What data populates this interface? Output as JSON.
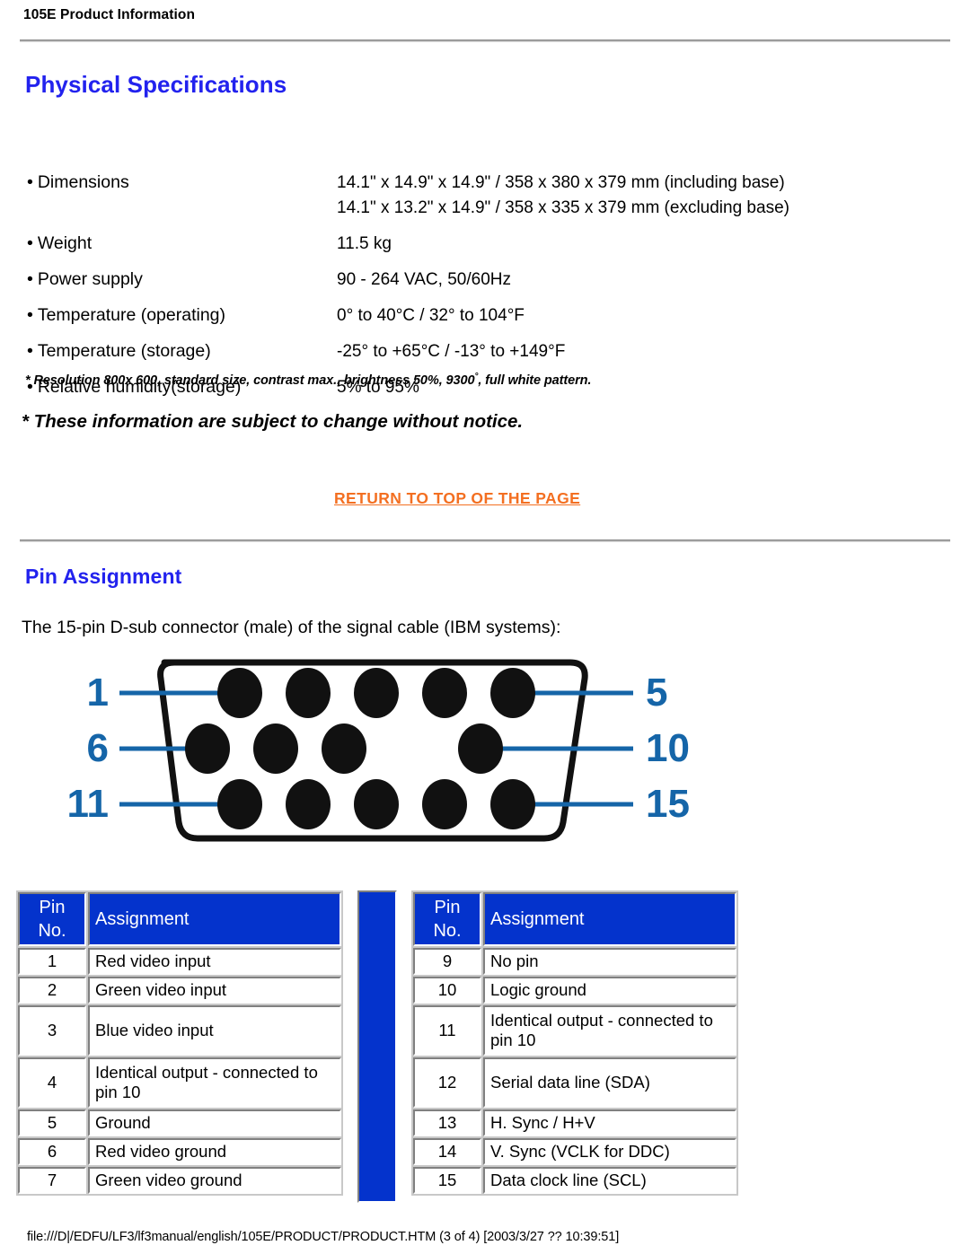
{
  "document": {
    "header_title": "105E Product Information",
    "footer_path": "file:///D|/EDFU/LF3/lf3manual/english/105E/PRODUCT/PRODUCT.HTM (3 of 4) [2003/3/27 ?? 10:39:51]"
  },
  "colors": {
    "heading_blue": "#2222EE",
    "table_header_blue": "#0433CC",
    "link_orange": "#F36F21",
    "diagram_blue": "#1565A8",
    "rule_gray": "#A9A9A9"
  },
  "physical_specifications": {
    "title": "Physical Specifications",
    "rows": [
      {
        "label": "Dimensions",
        "values": [
          "14.1\" x 14.9\" x 14.9\" / 358 x 380 x 379 mm (including base)",
          "14.1\" x 13.2\" x 14.9\" / 358 x 335 x 379 mm (excluding base)"
        ]
      },
      {
        "label": "Weight",
        "values": [
          "11.5 kg"
        ]
      },
      {
        "label": "Power supply",
        "values": [
          "90 - 264 VAC, 50/60Hz"
        ]
      },
      {
        "label": "Temperature (operating)",
        "values": [
          "0° to 40°C / 32° to 104°F"
        ]
      },
      {
        "label": "Temperature (storage)",
        "values": [
          "-25° to +65°C / -13° to +149°F"
        ]
      },
      {
        "label": "Relative humidity(storage)",
        "values": [
          "5% to 95%"
        ]
      }
    ],
    "footnote_small_a": "* Resolution 800x 600, standard size, contrast max., brightness 50%, 9300",
    "footnote_small_degree": "°",
    "footnote_small_b": ", full white pattern.",
    "footnote_big": "* These information are subject to change without notice."
  },
  "return_link": {
    "label": "RETURN TO TOP OF THE PAGE"
  },
  "pin_assignment": {
    "title": "Pin Assignment",
    "intro": "The 15-pin D-sub connector (male) of the signal cable (IBM systems):",
    "diagram": {
      "left_labels": [
        "1",
        "6",
        "11"
      ],
      "right_labels": [
        "5",
        "10",
        "15"
      ],
      "pin_rows": [
        {
          "count": 5,
          "missing": []
        },
        {
          "count": 5,
          "missing": [
            3
          ]
        },
        {
          "count": 5,
          "missing": []
        }
      ]
    },
    "table_headers": {
      "pin_no": "Pin\nNo.",
      "pin_no_line1": "Pin",
      "pin_no_line2": "No.",
      "assignment": "Assignment"
    },
    "left_rows": [
      {
        "pin": "1",
        "assignment": "Red video input",
        "lines": 1
      },
      {
        "pin": "2",
        "assignment": "Green video input",
        "lines": 1
      },
      {
        "pin": "3",
        "assignment": "Blue video input",
        "lines": 2
      },
      {
        "pin": "4",
        "assignment": "Identical output - connected to pin 10",
        "lines": 2
      },
      {
        "pin": "5",
        "assignment": "Ground",
        "lines": 1
      },
      {
        "pin": "6",
        "assignment": "Red video ground",
        "lines": 1
      },
      {
        "pin": "7",
        "assignment": "Green video ground",
        "lines": 1
      }
    ],
    "right_rows": [
      {
        "pin": "9",
        "assignment": "No pin",
        "lines": 1
      },
      {
        "pin": "10",
        "assignment": "Logic ground",
        "lines": 1
      },
      {
        "pin": "11",
        "assignment": "Identical output - connected to pin 10",
        "lines": 2
      },
      {
        "pin": "12",
        "assignment": "Serial data line (SDA)",
        "lines": 2
      },
      {
        "pin": "13",
        "assignment": "H. Sync / H+V",
        "lines": 1
      },
      {
        "pin": "14",
        "assignment": "V. Sync (VCLK for DDC)",
        "lines": 1
      },
      {
        "pin": "15",
        "assignment": "Data clock line (SCL)",
        "lines": 1
      }
    ]
  }
}
